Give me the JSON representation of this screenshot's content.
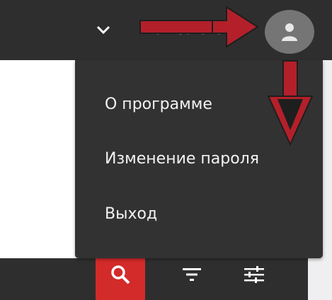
{
  "header": {
    "user_name": "Пользователь",
    "icons": {
      "dropdown": "chevron-down-icon",
      "avatar": "user-avatar-icon"
    }
  },
  "user_menu": {
    "items": [
      {
        "label": "О программе"
      },
      {
        "label": "Изменение пароля"
      },
      {
        "label": "Выход"
      }
    ]
  },
  "toolbar": {
    "icons": {
      "search": "search-icon",
      "filter": "filter-icon",
      "settings": "sliders-icon"
    }
  },
  "colors": {
    "header_bg": "#2e2e2e",
    "menu_bg": "#323232",
    "avatar_bg": "#757575",
    "accent_red": "#d32a2a",
    "annotation_arrow": "#b3202a"
  }
}
